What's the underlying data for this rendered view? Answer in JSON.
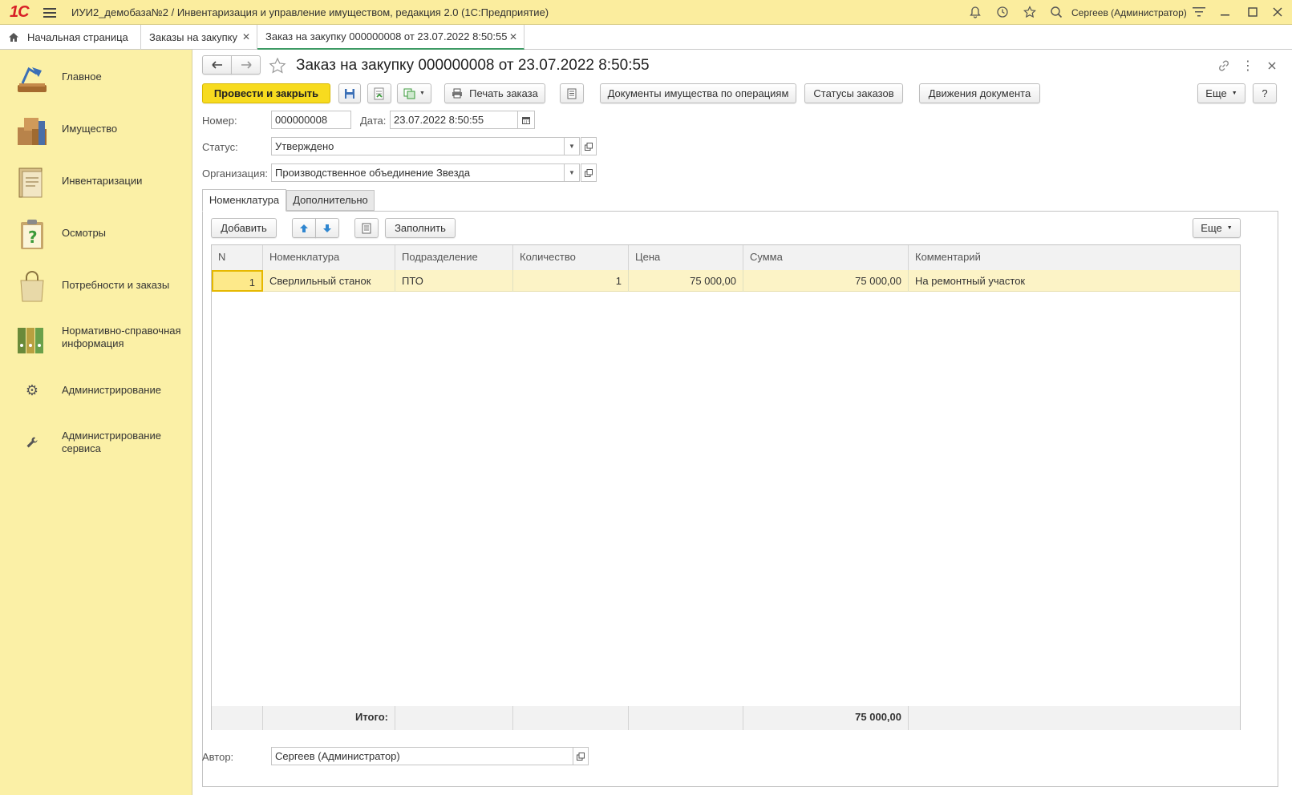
{
  "titlebar": {
    "logo": "1С",
    "title": "ИУИ2_демобаза№2 / Инвентаризация и управление имуществом, редакция 2.0  (1С:Предприятие)",
    "user": "Сергеев (Администратор)"
  },
  "tabs": [
    {
      "label": "Начальная страница"
    },
    {
      "label": "Заказы на закупку"
    },
    {
      "label": "Заказ на закупку 000000008 от 23.07.2022 8:50:55"
    }
  ],
  "sidebar": {
    "items": [
      {
        "label": "Главное"
      },
      {
        "label": "Имущество"
      },
      {
        "label": "Инвентаризации"
      },
      {
        "label": "Осмотры"
      },
      {
        "label": "Потребности и заказы"
      },
      {
        "label": "Нормативно-справочная",
        "label2": "информация"
      },
      {
        "label": "Администрирование"
      },
      {
        "label": "Администрирование",
        "label2": "сервиса"
      }
    ]
  },
  "form": {
    "title": "Заказ на закупку 000000008 от 23.07.2022 8:50:55",
    "toolbar": {
      "post_close": "Провести и закрыть",
      "print": "Печать заказа",
      "docs": "Документы имущества по операциям",
      "statuses": "Статусы заказов",
      "movements": "Движения документа",
      "more": "Еще",
      "help": "?"
    },
    "number_label": "Номер:",
    "number_value": "000000008",
    "date_label": "Дата:",
    "date_value": "23.07.2022  8:50:55",
    "status_label": "Статус:",
    "status_value": "Утверждено",
    "org_label": "Организация:",
    "org_value": "Производственное объединение Звезда",
    "tabs": [
      "Номенклатура",
      "Дополнительно"
    ],
    "table_toolbar": {
      "add": "Добавить",
      "fill": "Заполнить",
      "more": "Еще"
    },
    "columns": [
      "N",
      "Номенклатура",
      "Подразделение",
      "Количество",
      "Цена",
      "Сумма",
      "Комментарий"
    ],
    "rows": [
      {
        "n": "1",
        "item": "Сверлильный станок",
        "dept": "ПТО",
        "qty": "1",
        "price": "75 000,00",
        "sum": "75 000,00",
        "comment": "На ремонтный участок"
      }
    ],
    "total_label": "Итого:",
    "total_sum": "75 000,00",
    "author_label": "Автор:",
    "author_value": "Сергеев (Администратор)"
  },
  "colors": {
    "titlebar": "#fbed9e",
    "sidebar": "#fbf0a6",
    "primary_button": "#f7db1f",
    "selected_row": "#fcf3c6",
    "active_tab_underline": "#3d9a64"
  }
}
